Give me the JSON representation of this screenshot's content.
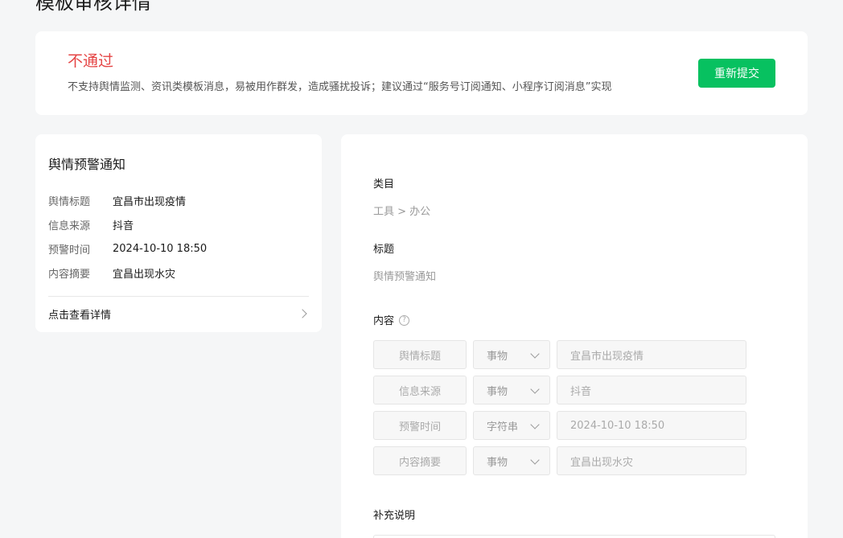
{
  "page": {
    "title": "模板审核详情"
  },
  "status": {
    "title": "不通过",
    "reason": "不支持舆情监测、资讯类模板消息，易被用作群发，造成骚扰投诉；建议通过“服务号订阅通知、小程序订阅消息”实现",
    "resubmit_label": "重新提交"
  },
  "preview": {
    "title": "舆情预警通知",
    "fields": [
      {
        "label": "舆情标题",
        "value": "宜昌市出现疫情"
      },
      {
        "label": "信息来源",
        "value": "抖音"
      },
      {
        "label": "预警时间",
        "value": "2024-10-10 18:50"
      },
      {
        "label": "内容摘要",
        "value": "宜昌出现水灾"
      }
    ],
    "detail_link": "点击查看详情"
  },
  "form": {
    "category_label": "类目",
    "category_value": "工具 > 办公",
    "title_label": "标题",
    "title_value": "舆情预警通知",
    "content_label": "内容",
    "help_glyph": "?",
    "keywords": [
      {
        "name": "舆情标题",
        "type": "事物",
        "example": "宜昌市出现疫情"
      },
      {
        "name": "信息来源",
        "type": "事物",
        "example": "抖音"
      },
      {
        "name": "预警时间",
        "type": "字符串",
        "example": "2024-10-10 18:50"
      },
      {
        "name": "内容摘要",
        "type": "事物",
        "example": "宜昌出现水灾"
      }
    ],
    "supplement_label": "补充说明"
  },
  "colors": {
    "accent": "#07c160",
    "reject": "#e54545",
    "background": "#f5f6f7"
  }
}
